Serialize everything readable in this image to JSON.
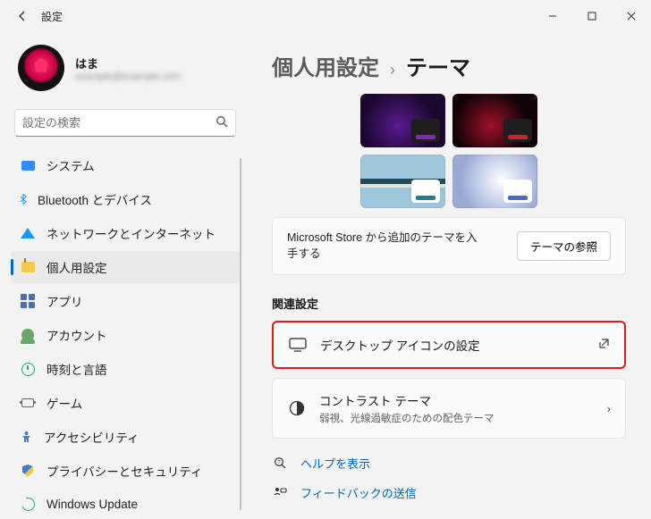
{
  "window": {
    "title": "設定"
  },
  "user": {
    "name": "はま",
    "email": "example@example.com"
  },
  "search": {
    "placeholder": "設定の検索"
  },
  "nav": [
    {
      "label": "システム"
    },
    {
      "label": "Bluetooth とデバイス"
    },
    {
      "label": "ネットワークとインターネット"
    },
    {
      "label": "個人用設定"
    },
    {
      "label": "アプリ"
    },
    {
      "label": "アカウント"
    },
    {
      "label": "時刻と言語"
    },
    {
      "label": "ゲーム"
    },
    {
      "label": "アクセシビリティ"
    },
    {
      "label": "プライバシーとセキュリティ"
    },
    {
      "label": "Windows Update"
    }
  ],
  "breadcrumb": {
    "parent": "個人用設定",
    "current": "テーマ"
  },
  "store": {
    "text": "Microsoft Store から追加のテーマを入手する",
    "button": "テーマの参照"
  },
  "related": {
    "heading": "関連設定"
  },
  "cards": {
    "desktopIcons": {
      "title": "デスクトップ アイコンの設定"
    },
    "contrast": {
      "title": "コントラスト テーマ",
      "sub": "弱視、光線過敏症のための配色テーマ"
    }
  },
  "links": {
    "help": "ヘルプを表示",
    "feedback": "フィードバックの送信"
  }
}
